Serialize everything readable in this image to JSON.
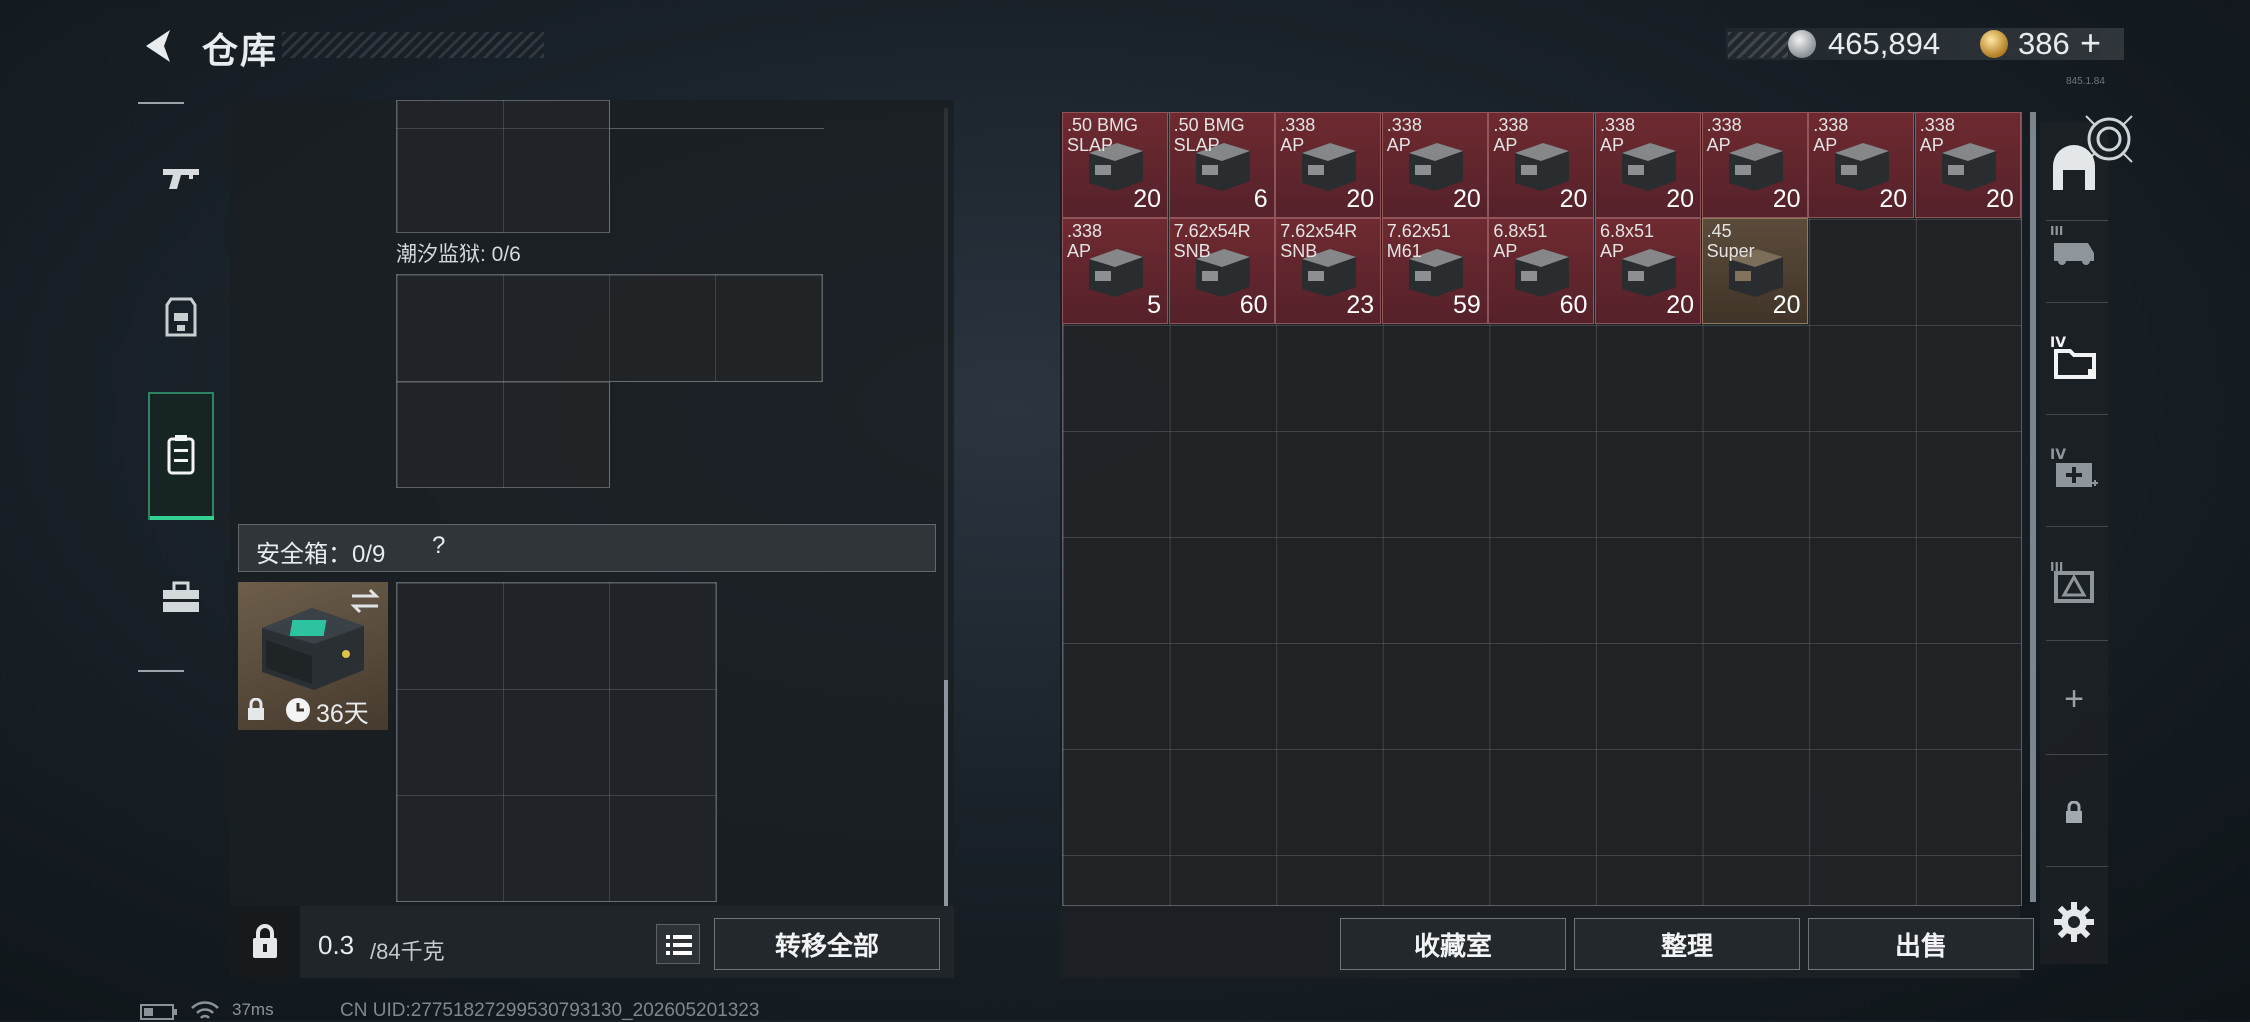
{
  "header": {
    "title": "仓库",
    "silver_amount": "465,894",
    "gold_amount": "386",
    "gold_plus": "+",
    "version": "845.1.84"
  },
  "sidebar": {
    "tabs": [
      {
        "name": "weapons",
        "icon": "pistol-icon"
      },
      {
        "name": "armor",
        "icon": "armor-icon"
      },
      {
        "name": "containers",
        "icon": "backpack-icon",
        "active": true
      },
      {
        "name": "other",
        "icon": "toolbox-icon"
      }
    ]
  },
  "left_panel": {
    "prison_label": "潮汐监狱: 0/6",
    "safe_label": "安全箱：0/9",
    "safe_help": "?",
    "safe_days": "36天",
    "weight_value": "0.3",
    "weight_unit": "/84千克",
    "transfer_all_label": "转移全部"
  },
  "storage": {
    "items": [
      {
        "name": ".50 BMG\nSLAP",
        "count": "20",
        "rarity": "red",
        "row": 0,
        "col": 0
      },
      {
        "name": ".50 BMG\nSLAP",
        "count": "6",
        "rarity": "red",
        "row": 0,
        "col": 1
      },
      {
        "name": ".338\nAP",
        "count": "20",
        "rarity": "red",
        "row": 0,
        "col": 2
      },
      {
        "name": ".338\nAP",
        "count": "20",
        "rarity": "red",
        "row": 0,
        "col": 3
      },
      {
        "name": ".338\nAP",
        "count": "20",
        "rarity": "red",
        "row": 0,
        "col": 4
      },
      {
        "name": ".338\nAP",
        "count": "20",
        "rarity": "red",
        "row": 0,
        "col": 5
      },
      {
        "name": ".338\nAP",
        "count": "20",
        "rarity": "red",
        "row": 0,
        "col": 6
      },
      {
        "name": ".338\nAP",
        "count": "20",
        "rarity": "red",
        "row": 0,
        "col": 7
      },
      {
        "name": ".338\nAP",
        "count": "20",
        "rarity": "red",
        "row": 0,
        "col": 8
      },
      {
        "name": ".338\nAP",
        "count": "5",
        "rarity": "red",
        "row": 1,
        "col": 0
      },
      {
        "name": "7.62x54R\nSNB",
        "count": "60",
        "rarity": "red",
        "row": 1,
        "col": 1
      },
      {
        "name": "7.62x54R\nSNB",
        "count": "23",
        "rarity": "red",
        "row": 1,
        "col": 2
      },
      {
        "name": "7.62x51\nM61",
        "count": "59",
        "rarity": "red",
        "row": 1,
        "col": 3
      },
      {
        "name": "6.8x51\nAP",
        "count": "60",
        "rarity": "red",
        "row": 1,
        "col": 4
      },
      {
        "name": "6.8x51\nAP",
        "count": "20",
        "rarity": "red",
        "row": 1,
        "col": 5
      },
      {
        "name": ".45\nSuper",
        "count": "20",
        "rarity": "gold",
        "row": 1,
        "col": 6
      }
    ],
    "collection_label": "收藏室",
    "sort_label": "整理",
    "sell_label": "出售"
  },
  "right_rail": {
    "items": [
      {
        "icon": "safehouse-icon"
      },
      {
        "icon": "tier-3-vehicle-icon",
        "tier": "III"
      },
      {
        "icon": "tier-4-folder-icon",
        "tier": "IV"
      },
      {
        "icon": "tier-4-medkit-icon",
        "tier": "IV"
      },
      {
        "icon": "tier-3-warning-icon",
        "tier": "III"
      },
      {
        "icon": "add-icon",
        "text": "+"
      },
      {
        "icon": "lock-icon"
      }
    ]
  },
  "status_bar": {
    "ping": "37ms",
    "uid": "CN UID:2775182729953079313​0_202605201323"
  },
  "colors": {
    "accent_green": "#33d18f",
    "item_red": "#6e2a30",
    "item_gold": "#5b4b3b"
  }
}
